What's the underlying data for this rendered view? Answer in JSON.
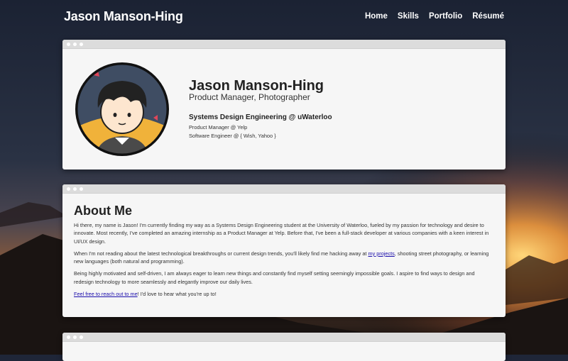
{
  "header": {
    "brand": "Jason Manson-Hing",
    "nav": [
      "Home",
      "Skills",
      "Portfolio",
      "Résumé"
    ]
  },
  "profile": {
    "name": "Jason Manson-Hing",
    "title": "Product Manager, Photographer",
    "education": "Systems Design Engineering @ uWaterloo",
    "roles": [
      "Product Manager @ Yelp",
      "Software Engineer @ { Wish, Yahoo }"
    ]
  },
  "about": {
    "heading": "About Me",
    "p1": "Hi there, my name is Jason! I'm currently finding my way as a Systems Design Engineering student at the University of Waterloo, fueled by my passion for technology and desire to innovate. Most recently, I've completed an amazing internship as a Product Manager at Yelp. Before that, I've been a full-stack developer at various companies with a keen interest in UI/UX design.",
    "p2_before": "When I'm not reading about the latest technological breakthroughs or current design trends, you'll likely find me hacking away at ",
    "p2_link": "my projects",
    "p2_after": ", shooting street photography, or learning new languages (both natural and programming).",
    "p3": "Being highly motivated and self-driven, I am always eager to learn new things and constantly find myself setting seemingly impossible goals. I aspire to find ways to design and redesign technology to more seamlessly and elegantly improve our daily lives.",
    "p4_link": "Feel free to reach out to me",
    "p4_after": "! I'd love to hear what you're up to!"
  },
  "colors": {
    "link": "#1a0dab",
    "card": "#f6f6f6",
    "chrome": "#dcdcdc"
  }
}
